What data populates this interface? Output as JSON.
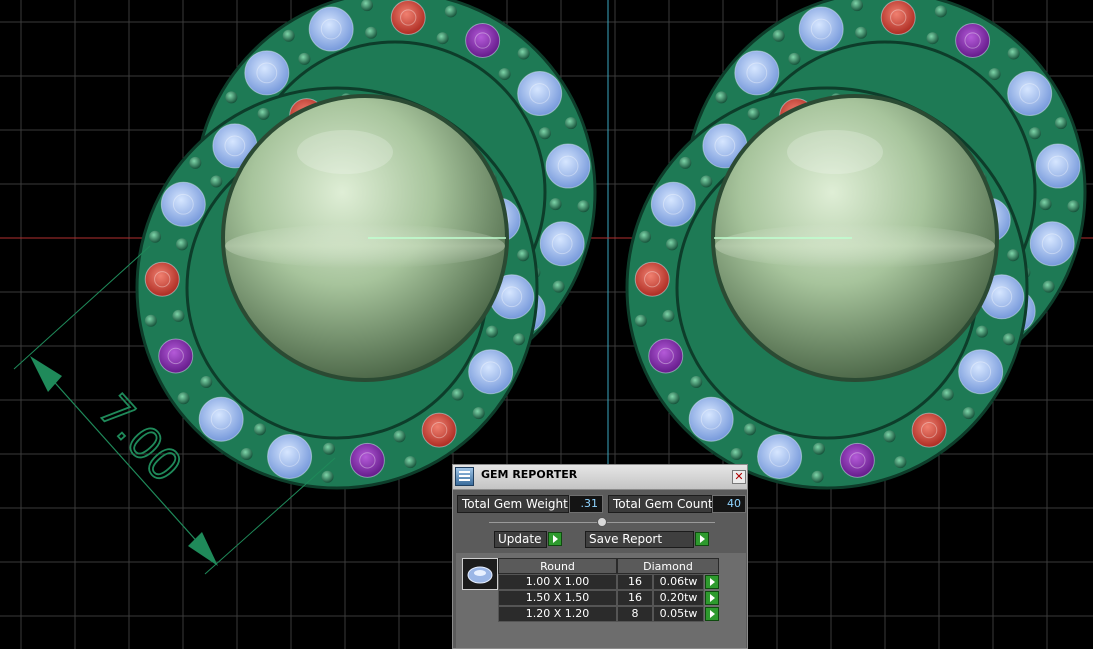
{
  "viewport": {
    "dimension_label": "7.00",
    "colors": {
      "background": "#000000",
      "grid": "#3a3a3a",
      "metal": "#1e7a55",
      "pearl": "#9fbf95",
      "diamond": "#8fb4f0",
      "ruby": "#c73a2e",
      "amethyst": "#7e2aa8",
      "dimension": "#1f8a5a"
    }
  },
  "gem_reporter": {
    "title": "GEM REPORTER",
    "close_icon": "close-icon",
    "total_weight_label": "Total Gem Weight",
    "total_weight_value": ".31",
    "total_count_label": "Total Gem Count",
    "total_count_value": "40",
    "update_label": "Update",
    "save_report_label": "Save Report",
    "table": {
      "shape_header": "Round",
      "type_header": "Diamond",
      "rows": [
        {
          "size": "1.00 X 1.00",
          "count": "16",
          "weight": "0.06tw"
        },
        {
          "size": "1.50 X 1.50",
          "count": "16",
          "weight": "0.20tw"
        },
        {
          "size": "1.20 X 1.20",
          "count": "8",
          "weight": "0.05tw"
        }
      ]
    }
  }
}
